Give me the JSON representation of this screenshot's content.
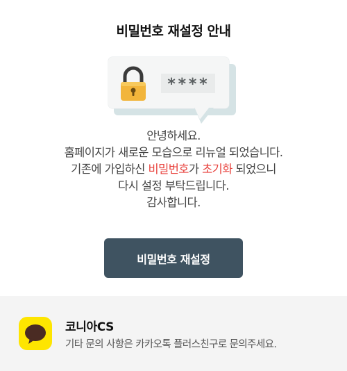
{
  "header": {
    "title": "비밀번호 재설정 안내"
  },
  "illustration": {
    "masked_password": "****",
    "accent": "#f2b53b"
  },
  "message": {
    "line1": "안녕하세요.",
    "line2": "홈페이지가 새로운 모습으로 리뉴얼 되었습니다.",
    "line3_pre": "기존에 가입하신 ",
    "line3_hl1": "비밀번호",
    "line3_mid": "가 ",
    "line3_hl2": "초기화",
    "line3_post": " 되었으니",
    "line4": "다시 설정 부탁드립니다.",
    "line5": "감사합니다.",
    "highlight_color": "#e8413c"
  },
  "actions": {
    "reset_label": "비밀번호 재설정",
    "button_color": "#3f5361"
  },
  "footer": {
    "name": "코니아CS",
    "description": "기타 문의 사항은 카카오톡 플러스친구로 문의주세요.",
    "icon": "kakao-talk-icon",
    "icon_color": "#fee500"
  }
}
